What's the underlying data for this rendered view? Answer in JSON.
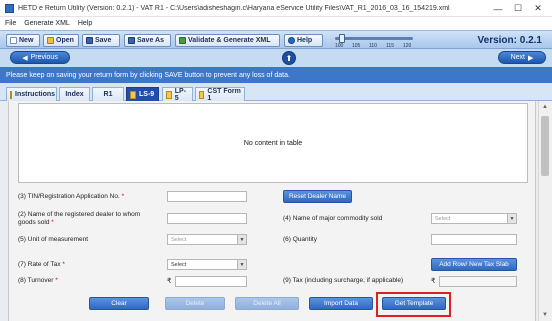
{
  "window": {
    "title": "HETD e Return Utility (Version: 0.2.1) - VAT R1 - C:\\Users\\adisheshagiri.c\\Haryana eService Utility Files\\VAT_R1_2016_03_16_154219.xml",
    "minimize": "—",
    "maximize": "☐",
    "close": "✕"
  },
  "menu": [
    "File",
    "Generate XML",
    "Help"
  ],
  "toolbar": {
    "new": "New",
    "open": "Open",
    "save": "Save",
    "save_as": "Save As",
    "validate": "Validate & Generate XML",
    "help": "Help",
    "zoom_ticks": [
      "100",
      "105",
      "110",
      "115",
      "120"
    ],
    "zoom_value": 100,
    "version": "Version:  0.2.1"
  },
  "nav": {
    "previous": "Previous",
    "next": "Next",
    "up": "⬆"
  },
  "info_message": "Please keep on saving your return form by clicking SAVE button to prevent any loss of data.",
  "tabs": [
    {
      "label": "Instructions",
      "active": false,
      "icon": "doc-icon"
    },
    {
      "label": "Index",
      "active": false,
      "icon": null
    },
    {
      "label": "R1",
      "active": false,
      "icon": null
    },
    {
      "label": "LS-9",
      "active": true,
      "icon": "doc-icon"
    },
    {
      "label": "LP-5",
      "active": false,
      "icon": "doc-icon"
    },
    {
      "label": "CST Form 1",
      "active": false,
      "icon": "doc-icon"
    }
  ],
  "table": {
    "empty_message": "No content in table"
  },
  "form": {
    "tin_label": "(3) TIN/Registration Application No.",
    "tin_value": "",
    "reset_dealer_button": "Reset Dealer Name",
    "dealer_name_label": "(2) Name of the registered dealer to whom goods sold",
    "dealer_name_value": "",
    "commodity_label": "(4) Name of major commodity sold",
    "commodity_placeholder": "Select",
    "unit_label": "(5) Unit of measurement",
    "unit_placeholder": "Select",
    "quantity_label": "(6) Quantity",
    "quantity_value": "",
    "rate_label": "(7) Rate of Tax",
    "rate_placeholder": "Select",
    "add_row_button": "Add Row/ New Tax Slab",
    "turnover_label": "(8) Turnover",
    "turnover_currency": "₹",
    "tax_label": "(9) Tax (including surcharge, if applicable)",
    "tax_currency": "₹",
    "required_mark": "*"
  },
  "actions": {
    "clear": "Clear",
    "delete": "Delete",
    "delete_all": "Delete All",
    "import_data": "Import Data",
    "get_template": "Get Template"
  },
  "colors": {
    "accent": "#2f68bf",
    "info_bar": "#3c77c9",
    "highlight": "#e02020"
  }
}
